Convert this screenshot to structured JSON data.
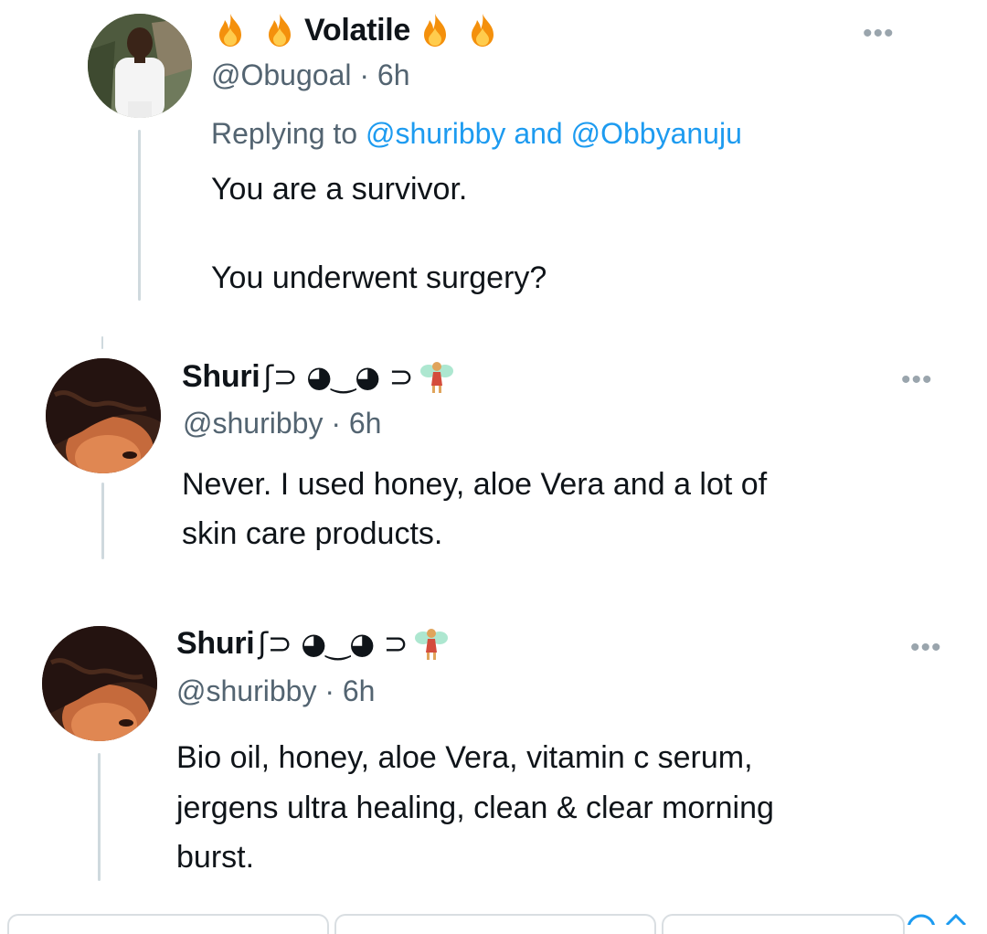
{
  "tweets": [
    {
      "display_name": "Volatile",
      "name_emoji": "fire-icon",
      "handle": "@Obugoal",
      "sep": "·",
      "time": "6h",
      "replying_prefix": "Replying to",
      "replying_to_1": "@shuribby",
      "replying_and": "and",
      "replying_to_2": "@Obbyanuju",
      "lines": [
        "You are a survivor.",
        "You underwent surgery?"
      ]
    },
    {
      "display_name": "Shuri",
      "kaomoji": "ʃ⊃ ◕‿◕ ⊃",
      "name_emoji": "fairy-icon",
      "handle": "@shuribby",
      "sep": "·",
      "time": "6h",
      "lines": [
        "Never. I used honey, aloe Vera and a lot of",
        "skin care products."
      ]
    },
    {
      "display_name": "Shuri",
      "kaomoji": "ʃ⊃ ◕‿◕ ⊃",
      "name_emoji": "fairy-icon",
      "handle": "@shuribby",
      "sep": "·",
      "time": "6h",
      "lines": [
        "Bio oil, honey, aloe Vera, vitamin c serum,",
        "jergens ultra healing, clean & clear morning",
        "burst."
      ]
    }
  ],
  "more_label": "•••"
}
